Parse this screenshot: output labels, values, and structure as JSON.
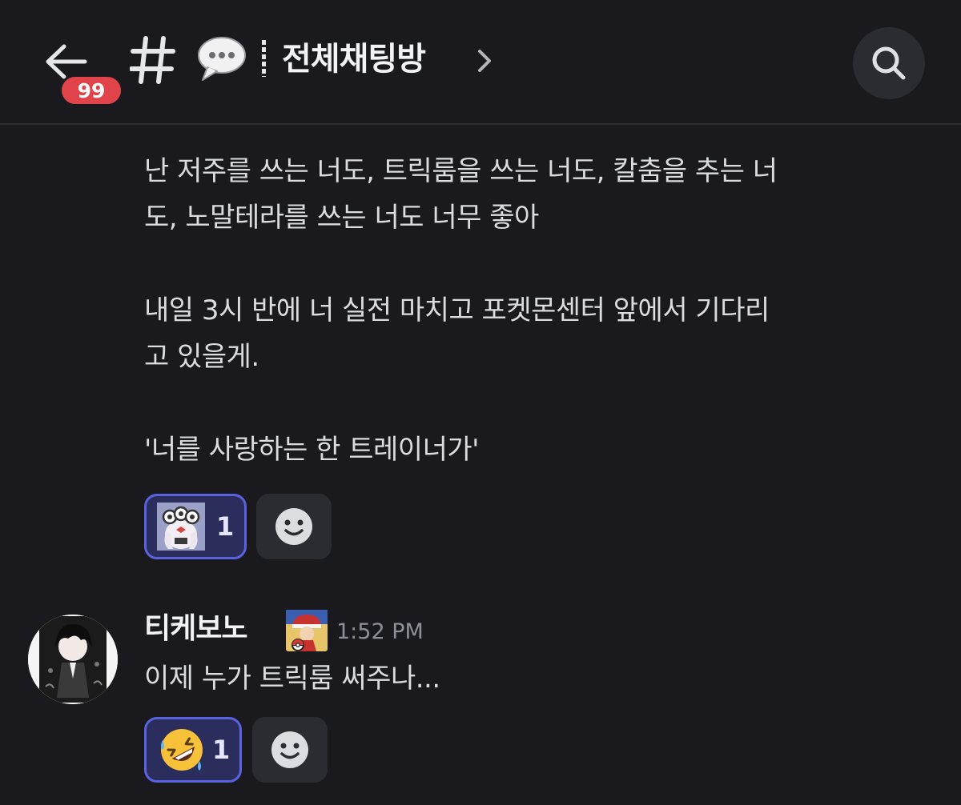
{
  "header": {
    "unread_badge": "99",
    "channel_name": "전체채팅방"
  },
  "messages": [
    {
      "lines": [
        "난 저주를 쓰는 너도, 트릭룸을 쓰는 너도, 칼춤을 추는 너",
        "도, 노말테라를 쓰는 너도 너무 좋아",
        "",
        "내일 3시 반에 너 실전 마치고 포켓몬센터 앞에서 기다리",
        "고 있을게.",
        "",
        "'너를 사랑하는 한 트레이너가'"
      ],
      "reaction": {
        "emoji": "custom-creature-emoji",
        "count": "1"
      }
    },
    {
      "username": "티케보노",
      "timestamp": "1:52 PM",
      "text": "이제 누가 트릭룸 써주나...",
      "reaction": {
        "emoji": "rolling-on-floor-laughing-emoji",
        "count": "1"
      }
    }
  ],
  "colors": {
    "background": "#1a1a1e",
    "badge": "#e0444a",
    "reaction_active_bg": "#2b2e5c",
    "reaction_active_border": "#5a62e0",
    "reaction_add_bg": "#2b2c31"
  }
}
